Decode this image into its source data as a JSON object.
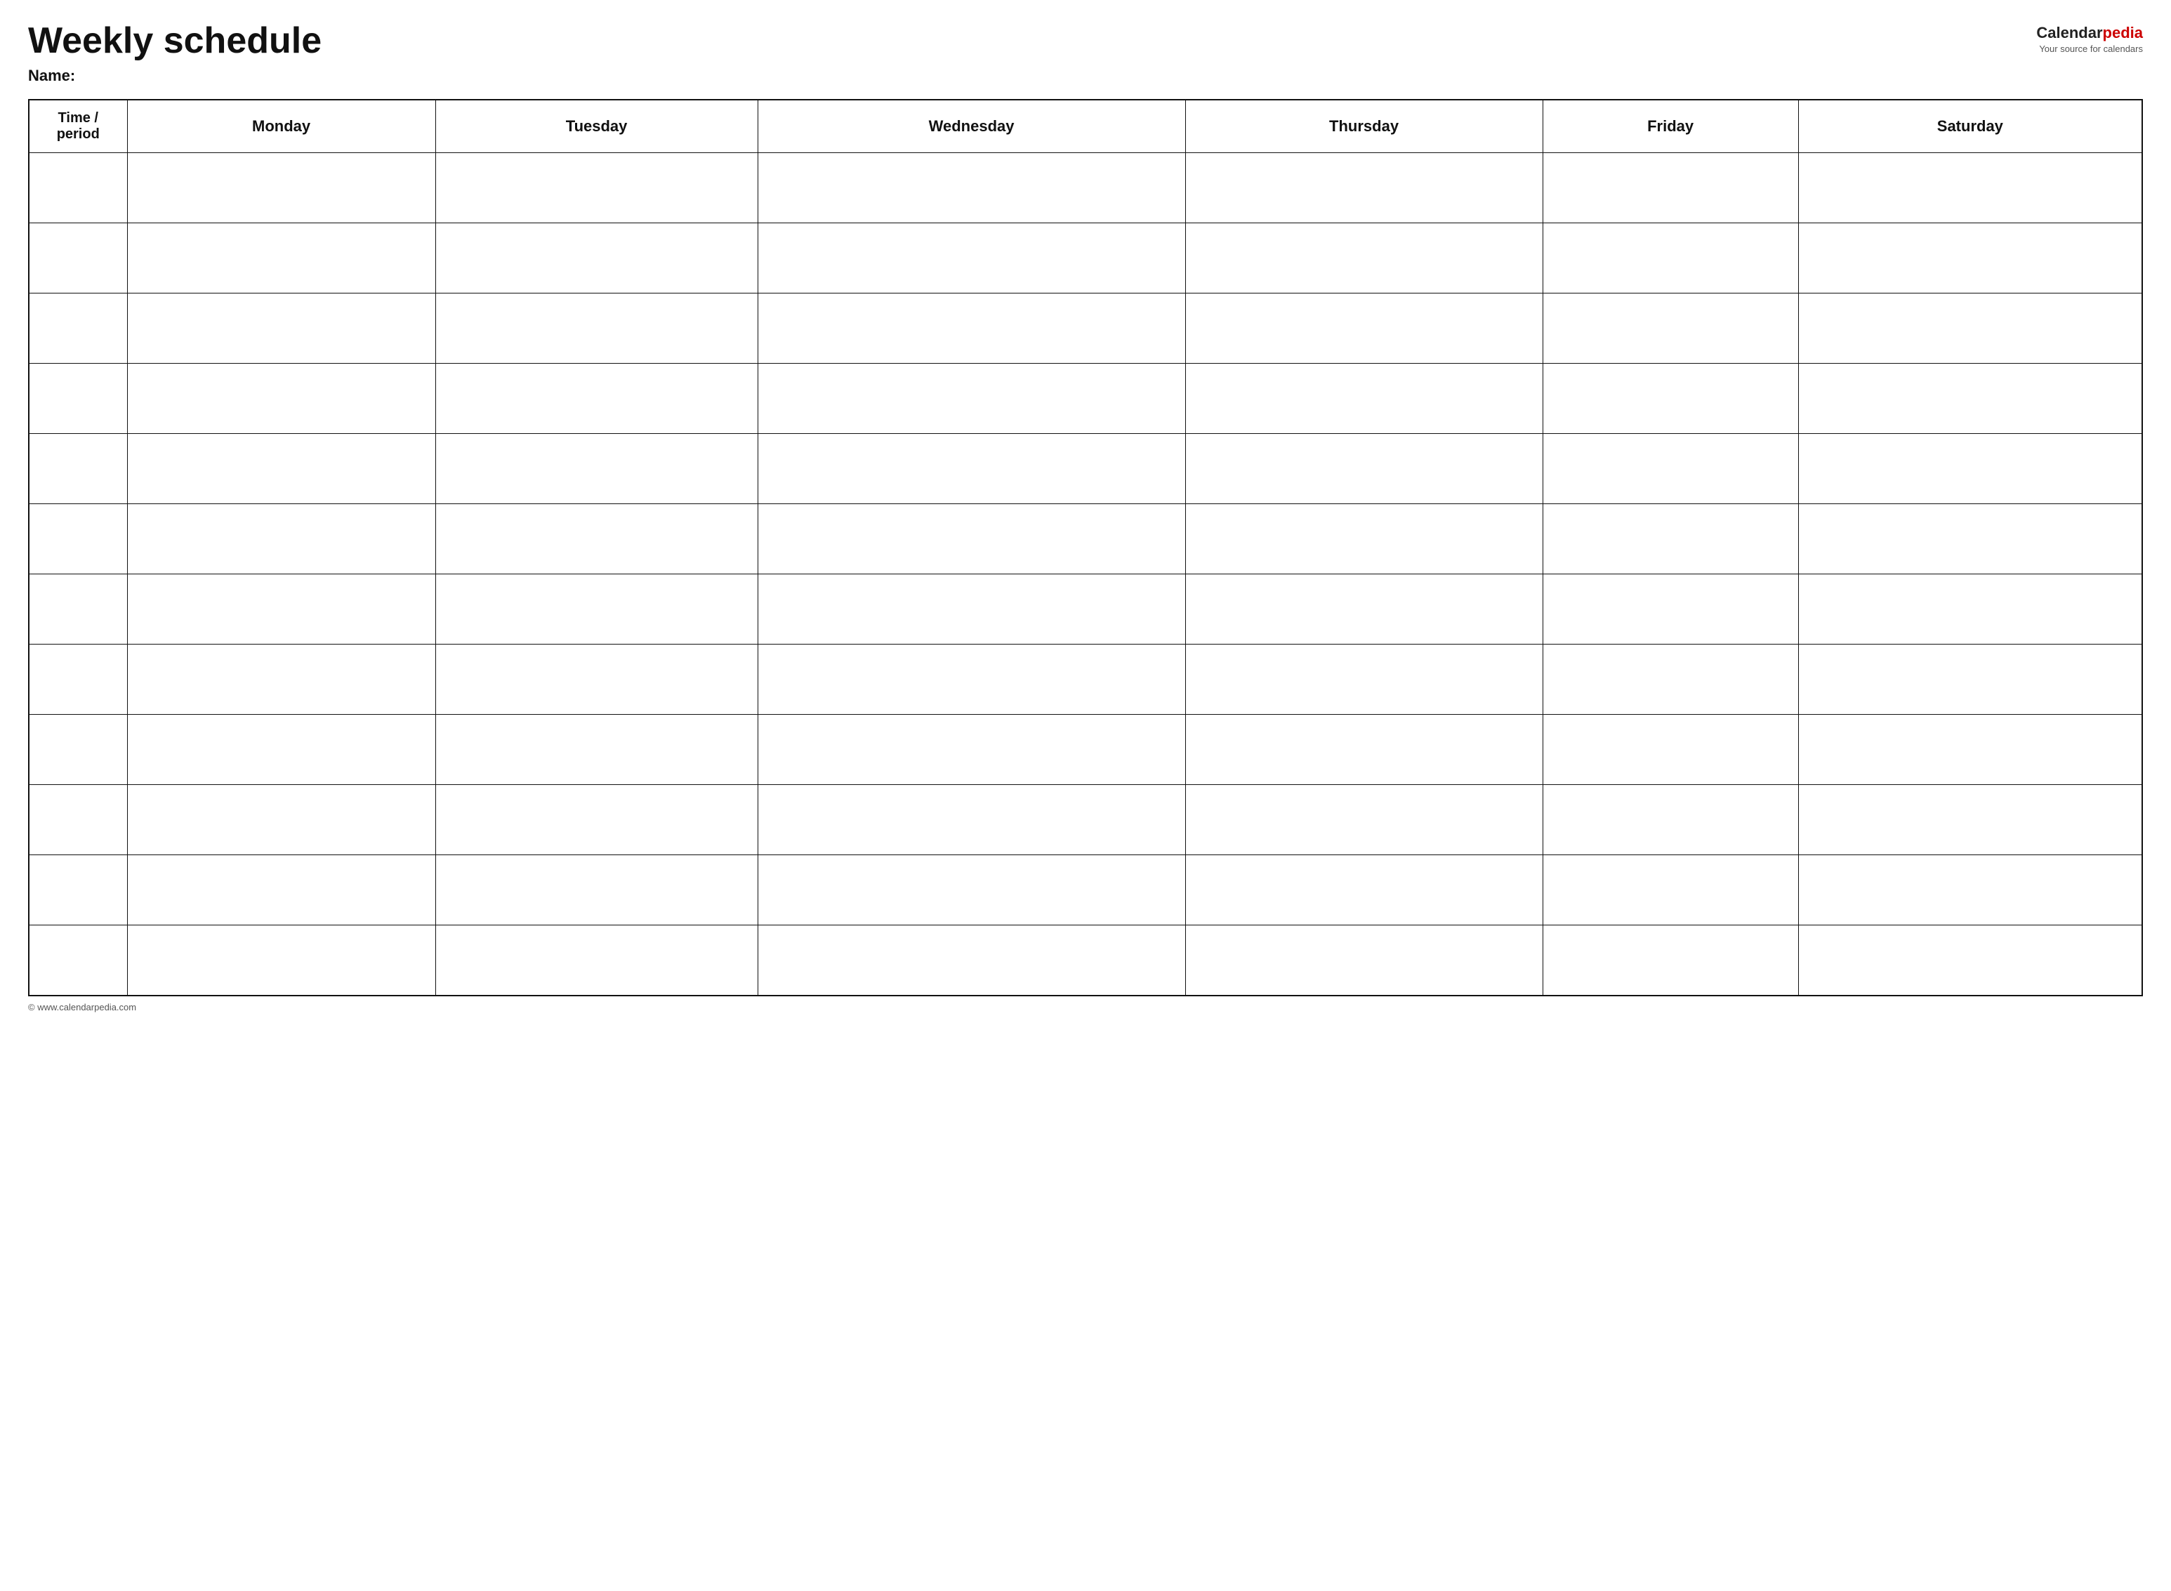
{
  "header": {
    "title": "Weekly schedule",
    "name_label": "Name:",
    "logo": {
      "part1": "Calendar",
      "part2": "pedia",
      "subtext": "Your source for calendars"
    }
  },
  "table": {
    "columns": [
      "Time / period",
      "Monday",
      "Tuesday",
      "Wednesday",
      "Thursday",
      "Friday",
      "Saturday"
    ],
    "row_count": 12
  },
  "footer": {
    "text": "© www.calendarpedia.com"
  }
}
